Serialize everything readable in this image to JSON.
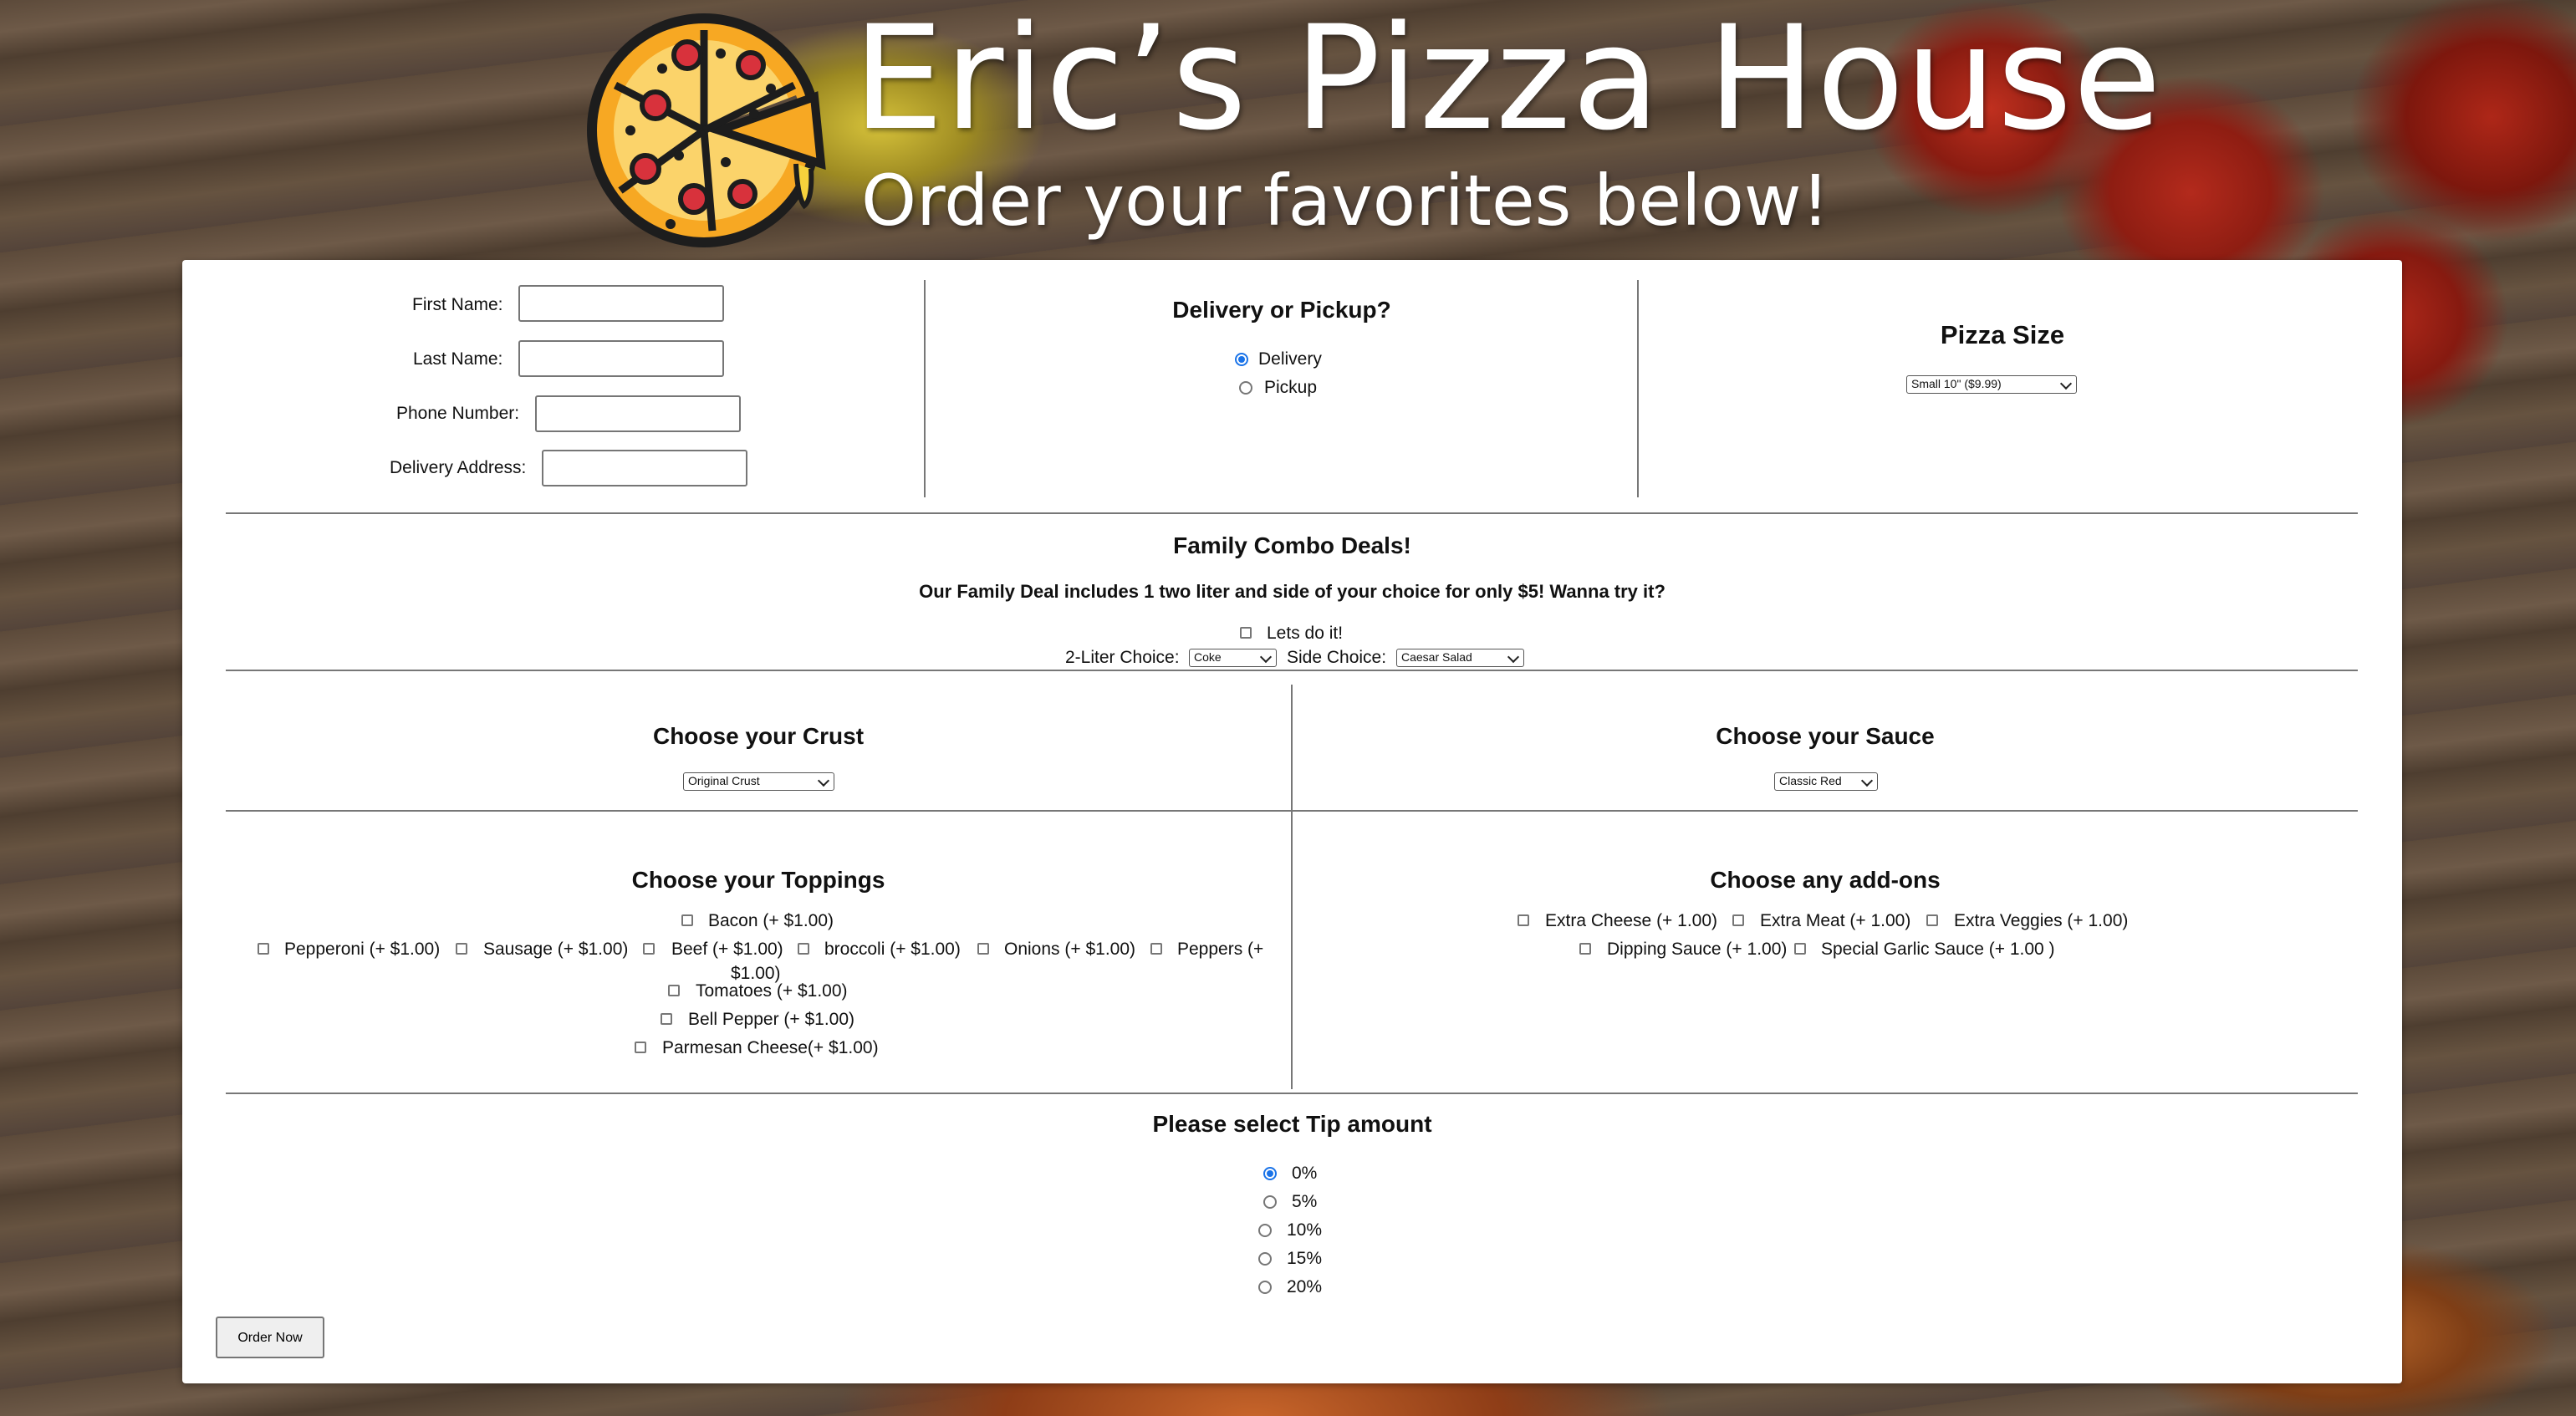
{
  "header": {
    "title": "Eric’s Pizza House",
    "subtitle": "Order your favorites below!"
  },
  "customer": {
    "first_name_label": "First Name:",
    "last_name_label": "Last Name:",
    "phone_label": "Phone Number:",
    "address_label": "Delivery Address:",
    "first_name_value": "",
    "last_name_value": "",
    "phone_value": "",
    "address_value": ""
  },
  "delivery": {
    "heading": "Delivery or Pickup?",
    "options": [
      {
        "label": "Delivery",
        "selected": true
      },
      {
        "label": "Pickup",
        "selected": false
      }
    ]
  },
  "size": {
    "heading": "Pizza Size",
    "selected": "Small 10\" ($9.99)"
  },
  "combo": {
    "heading": "Family Combo Deals!",
    "description": "Our Family Deal includes 1 two liter and side of your choice for only $5! Wanna try it?",
    "checkbox_label": "Lets do it!",
    "liter_label": "2-Liter Choice:",
    "liter_selected": "Coke",
    "side_label": "Side Choice:",
    "side_selected": "Caesar Salad"
  },
  "crust": {
    "heading": "Choose your Crust",
    "selected": "Original Crust"
  },
  "sauce": {
    "heading": "Choose your Sauce",
    "selected": "Classic Red"
  },
  "toppings": {
    "heading": "Choose your Toppings",
    "items": [
      "Bacon (+ $1.00)",
      "Pepperoni (+ $1.00)",
      "Sausage (+ $1.00)",
      "Beef (+ $1.00)",
      "broccoli (+ $1.00)",
      "Onions (+ $1.00)",
      "Peppers (+",
      "$1.00)",
      "Tomatoes (+ $1.00)",
      "Bell Pepper (+ $1.00)",
      "Parmesan Cheese(+ $1.00)"
    ]
  },
  "addons": {
    "heading": "Choose any add-ons",
    "items": [
      "Extra Cheese (+ 1.00)",
      "Extra Meat (+ 1.00)",
      "Extra Veggies (+ 1.00)",
      "Dipping Sauce (+ 1.00)",
      "Special Garlic Sauce (+ 1.00 )"
    ]
  },
  "tip": {
    "heading": "Please select Tip amount",
    "options": [
      {
        "label": "0%",
        "selected": true
      },
      {
        "label": "5%",
        "selected": false
      },
      {
        "label": "10%",
        "selected": false
      },
      {
        "label": "15%",
        "selected": false
      },
      {
        "label": "20%",
        "selected": false
      }
    ]
  },
  "order_button_label": "Order Now",
  "colors": {
    "accent_radio": "#1a73e8",
    "logo_orange": "#f5a623",
    "logo_outline": "#1d1d1d",
    "pepperoni_red": "#d8323c"
  },
  "icons": {
    "logo": "pizza-logo-icon"
  }
}
